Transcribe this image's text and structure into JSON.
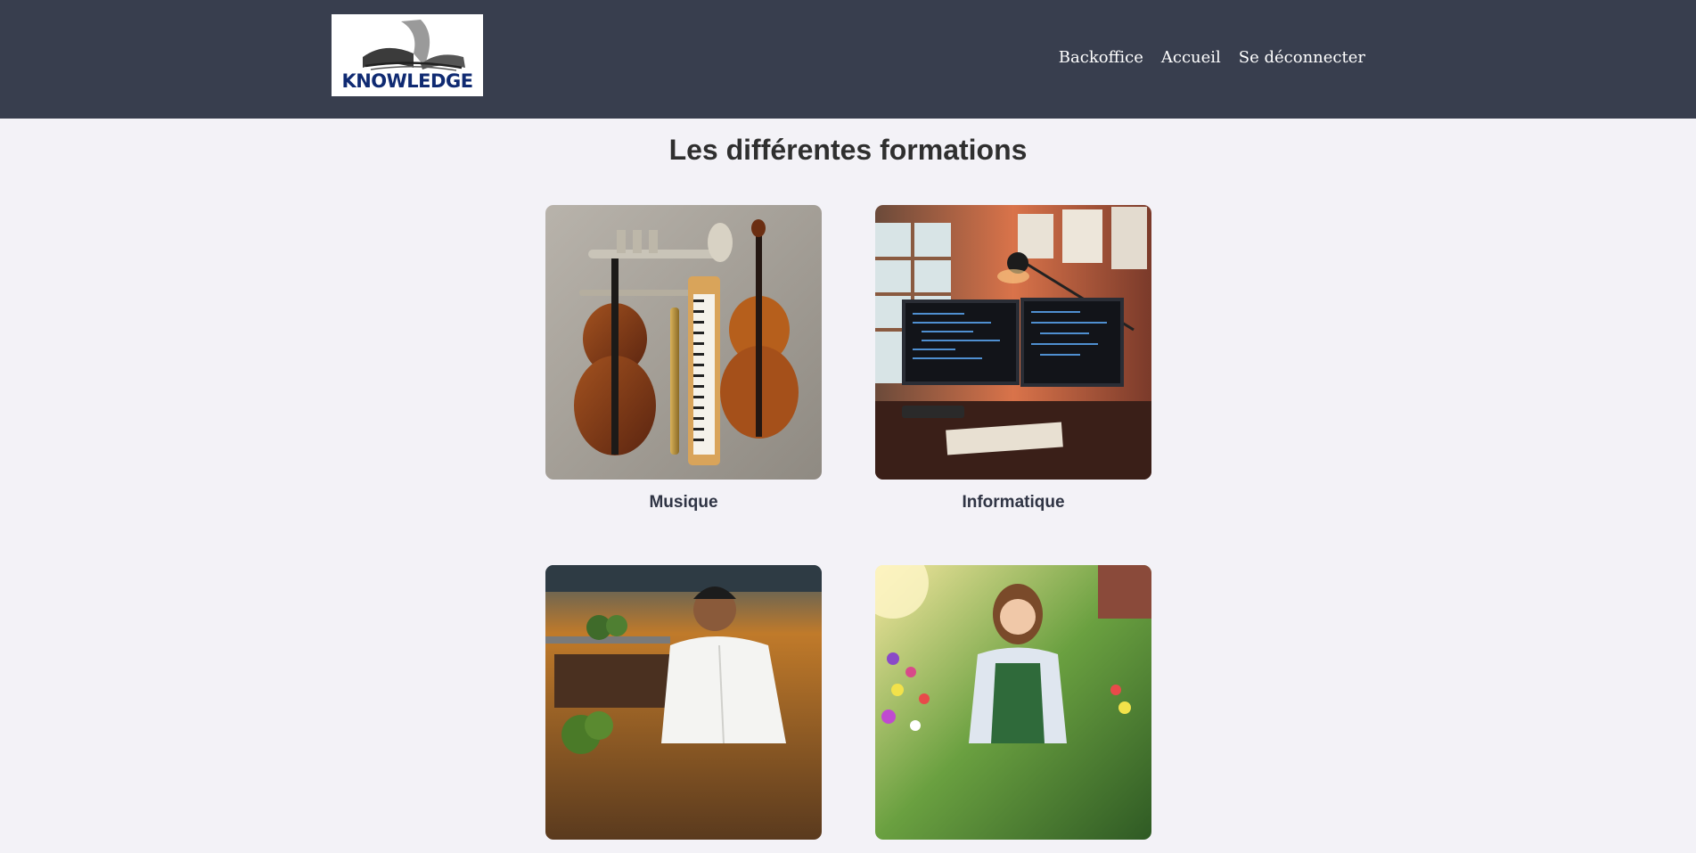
{
  "header": {
    "logo_text": "KNOWLEDGE",
    "nav": [
      {
        "label": "Backoffice"
      },
      {
        "label": "Accueil"
      },
      {
        "label": "Se déconnecter"
      }
    ]
  },
  "main": {
    "title": "Les différentes formations",
    "formations": [
      {
        "label": "Musique",
        "image": "music-instruments-image"
      },
      {
        "label": "Informatique",
        "image": "computer-workspace-image"
      },
      {
        "label": "",
        "image": "chef-cooking-image"
      },
      {
        "label": "",
        "image": "gardener-image"
      }
    ]
  },
  "colors": {
    "navbar": "#383e4e",
    "background": "#f3f2f7",
    "logo_blue": "#0f2a72"
  }
}
